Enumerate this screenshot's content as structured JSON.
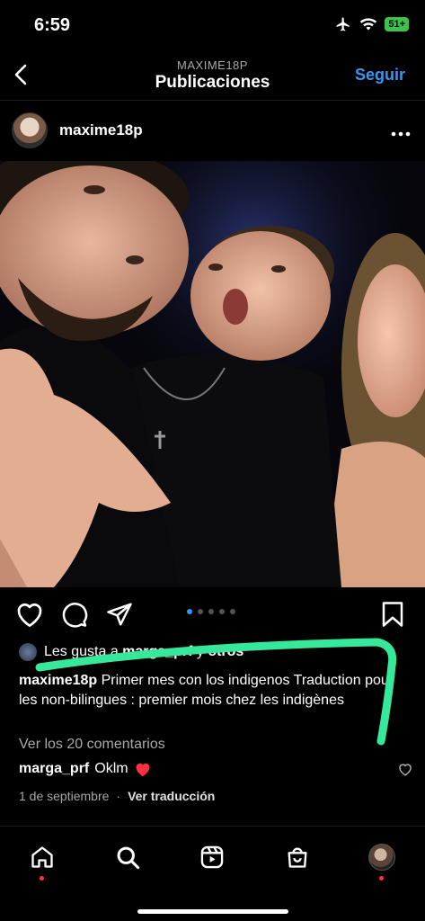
{
  "status": {
    "time": "6:59",
    "battery": "51+"
  },
  "header": {
    "subtitle": "MAXIME18P",
    "title": "Publicaciones",
    "follow_label": "Seguir"
  },
  "post": {
    "username": "maxime18p",
    "likes_prefix": "Les gusta a ",
    "likes_user": "marga_prf",
    "likes_suffix": " y ",
    "likes_others": "otros",
    "caption_user": "maxime18p",
    "caption_text": "Primer mes con los indigenos Traduction pour les non-bilingues : premier mois chez les indigènes",
    "view_comments": "Ver los 20 comentarios",
    "comment_user": "marga_prf",
    "comment_text": "Oklm",
    "date": "1 de septiembre",
    "date_sep": "·",
    "translate_label": "Ver traducción",
    "carousel_count": 5,
    "carousel_active": 0
  },
  "icons": {
    "back": "chevron-left-icon",
    "more": "more-horizontal-icon",
    "like": "heart-icon",
    "comment": "comment-icon",
    "share": "send-icon",
    "save": "bookmark-icon",
    "home": "home-icon",
    "search": "search-icon",
    "reels": "reels-icon",
    "shop": "shop-icon"
  },
  "colors": {
    "accent": "#3897f0",
    "heart": "#ff3040",
    "annotation": "#35e89a"
  }
}
